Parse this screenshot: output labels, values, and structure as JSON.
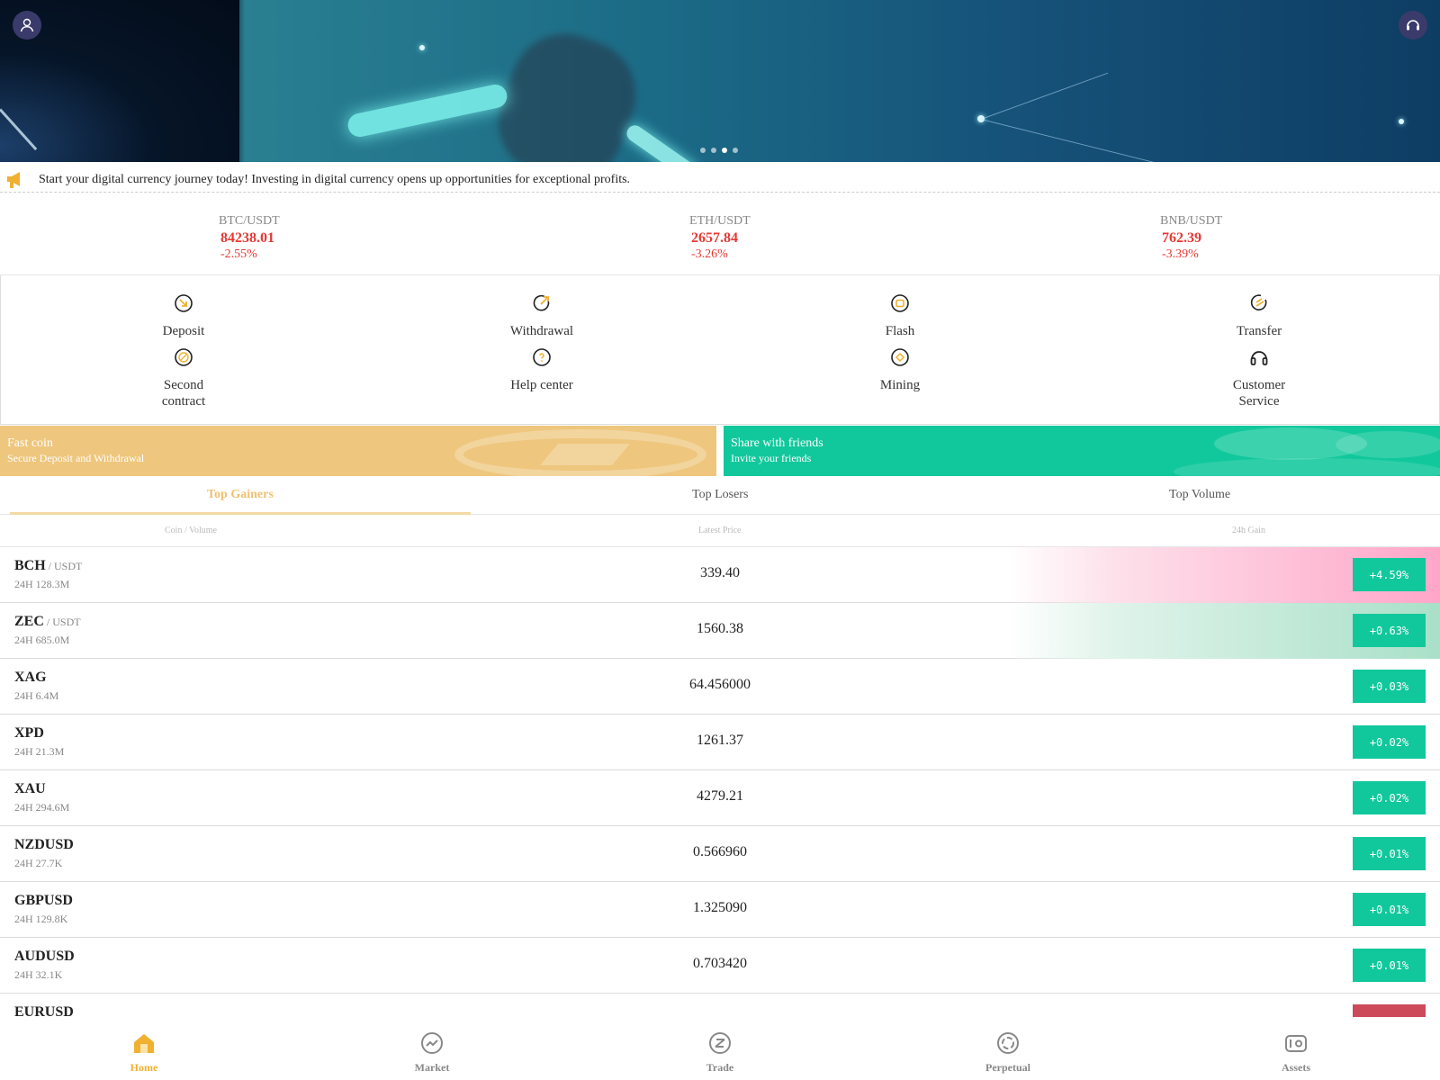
{
  "banner": {
    "active_slide": 3,
    "slide_count": 4
  },
  "notice": {
    "text": "Start your digital currency journey today! Investing in digital currency opens up opportunities for exceptional profits."
  },
  "tickers": [
    {
      "pair": "BTC/USDT",
      "price": "84238.01",
      "change": "-2.55%"
    },
    {
      "pair": "ETH/USDT",
      "price": "2657.84",
      "change": "-3.26%"
    },
    {
      "pair": "BNB/USDT",
      "price": "762.39",
      "change": "-3.39%"
    }
  ],
  "functions": [
    {
      "label": "Deposit",
      "icon": "deposit-icon"
    },
    {
      "label": "Withdrawal",
      "icon": "withdrawal-icon"
    },
    {
      "label": "Flash",
      "icon": "flash-icon"
    },
    {
      "label": "Transfer",
      "icon": "transfer-icon"
    },
    {
      "label": "Second\ncontract",
      "icon": "second-contract-icon"
    },
    {
      "label": "Help center",
      "icon": "help-icon"
    },
    {
      "label": "Mining",
      "icon": "mining-icon"
    },
    {
      "label": "Customer\nService",
      "icon": "headphones-icon"
    }
  ],
  "promos": {
    "fast_coin": {
      "title": "Fast coin",
      "subtitle": "Secure Deposit and Withdrawal"
    },
    "share": {
      "title": "Share with friends",
      "subtitle": "Invite your friends"
    }
  },
  "tabs": {
    "gainers": "Top Gainers",
    "losers": "Top Losers",
    "volume": "Top Volume",
    "active": "gainers"
  },
  "table_header": {
    "coin": "Coin / Volume",
    "price": "Latest Price",
    "gain": "24h Gain"
  },
  "rows": [
    {
      "symbol": "BCH",
      "quote": " / USDT",
      "volume": "24H 128.3M",
      "price": "339.40",
      "gain": "+4.59%",
      "highlight": "pink"
    },
    {
      "symbol": "ZEC",
      "quote": " / USDT",
      "volume": "24H 685.0M",
      "price": "1560.38",
      "gain": "+0.63%",
      "highlight": "green"
    },
    {
      "symbol": "XAG",
      "quote": "",
      "volume": "24H 6.4M",
      "price": "64.456000",
      "gain": "+0.03%",
      "highlight": ""
    },
    {
      "symbol": "XPD",
      "quote": "",
      "volume": "24H 21.3M",
      "price": "1261.37",
      "gain": "+0.02%",
      "highlight": ""
    },
    {
      "symbol": "XAU",
      "quote": "",
      "volume": "24H 294.6M",
      "price": "4279.21",
      "gain": "+0.02%",
      "highlight": ""
    },
    {
      "symbol": "NZDUSD",
      "quote": "",
      "volume": "24H 27.7K",
      "price": "0.566960",
      "gain": "+0.01%",
      "highlight": ""
    },
    {
      "symbol": "GBPUSD",
      "quote": "",
      "volume": "24H 129.8K",
      "price": "1.325090",
      "gain": "+0.01%",
      "highlight": ""
    },
    {
      "symbol": "AUDUSD",
      "quote": "",
      "volume": "24H 32.1K",
      "price": "0.703420",
      "gain": "+0.01%",
      "highlight": ""
    },
    {
      "symbol": "EURUSD",
      "quote": "",
      "volume": "",
      "price": "",
      "gain": "",
      "highlight": "red"
    }
  ],
  "bottom_nav": [
    {
      "label": "Home",
      "icon": "home-icon",
      "active": true
    },
    {
      "label": "Market",
      "icon": "market-icon",
      "active": false
    },
    {
      "label": "Trade",
      "icon": "trade-icon",
      "active": false
    },
    {
      "label": "Perpetual",
      "icon": "perpetual-icon",
      "active": false
    },
    {
      "label": "Assets",
      "icon": "wallet-icon",
      "active": false
    }
  ],
  "colors": {
    "gold": "#eec67d",
    "green": "#11c89c",
    "red": "#e53935",
    "accent": "#f0b130",
    "nav_bg": "#3a3b6a"
  }
}
